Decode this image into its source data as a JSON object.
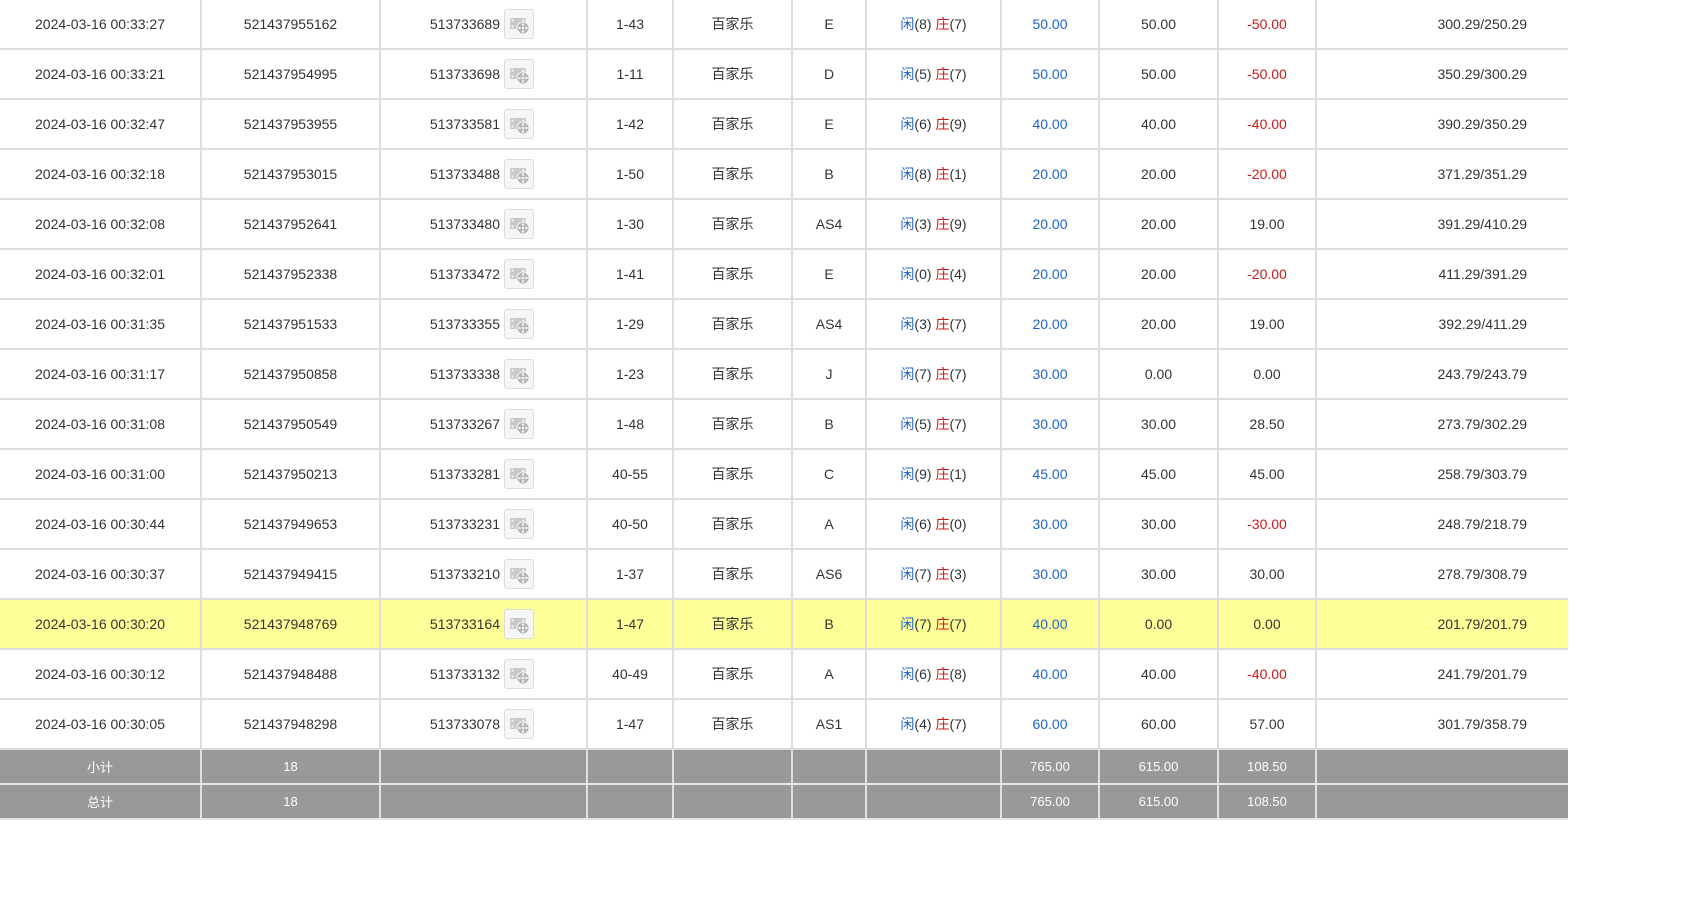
{
  "rows": [
    {
      "time": "2024-03-16 00:33:27",
      "bet_id": "521437955162",
      "round_id": "513733689",
      "table": "1-43",
      "game": "百家乐",
      "bet_area": "E",
      "player_label": "闲",
      "player_score": "(8)",
      "banker_label": "庄",
      "banker_score": "(7)",
      "bet_amount": "50.00",
      "valid_bet": "50.00",
      "payout": "-50.00",
      "payout_negative": true,
      "balance": "300.29/250.29",
      "highlight": false
    },
    {
      "time": "2024-03-16 00:33:21",
      "bet_id": "521437954995",
      "round_id": "513733698",
      "table": "1-11",
      "game": "百家乐",
      "bet_area": "D",
      "player_label": "闲",
      "player_score": "(5)",
      "banker_label": "庄",
      "banker_score": "(7)",
      "bet_amount": "50.00",
      "valid_bet": "50.00",
      "payout": "-50.00",
      "payout_negative": true,
      "balance": "350.29/300.29",
      "highlight": false
    },
    {
      "time": "2024-03-16 00:32:47",
      "bet_id": "521437953955",
      "round_id": "513733581",
      "table": "1-42",
      "game": "百家乐",
      "bet_area": "E",
      "player_label": "闲",
      "player_score": "(6)",
      "banker_label": "庄",
      "banker_score": "(9)",
      "bet_amount": "40.00",
      "valid_bet": "40.00",
      "payout": "-40.00",
      "payout_negative": true,
      "balance": "390.29/350.29",
      "highlight": false
    },
    {
      "time": "2024-03-16 00:32:18",
      "bet_id": "521437953015",
      "round_id": "513733488",
      "table": "1-50",
      "game": "百家乐",
      "bet_area": "B",
      "player_label": "闲",
      "player_score": "(8)",
      "banker_label": "庄",
      "banker_score": "(1)",
      "bet_amount": "20.00",
      "valid_bet": "20.00",
      "payout": "-20.00",
      "payout_negative": true,
      "balance": "371.29/351.29",
      "highlight": false
    },
    {
      "time": "2024-03-16 00:32:08",
      "bet_id": "521437952641",
      "round_id": "513733480",
      "table": "1-30",
      "game": "百家乐",
      "bet_area": "AS4",
      "player_label": "闲",
      "player_score": "(3)",
      "banker_label": "庄",
      "banker_score": "(9)",
      "bet_amount": "20.00",
      "valid_bet": "20.00",
      "payout": "19.00",
      "payout_negative": false,
      "balance": "391.29/410.29",
      "highlight": false
    },
    {
      "time": "2024-03-16 00:32:01",
      "bet_id": "521437952338",
      "round_id": "513733472",
      "table": "1-41",
      "game": "百家乐",
      "bet_area": "E",
      "player_label": "闲",
      "player_score": "(0)",
      "banker_label": "庄",
      "banker_score": "(4)",
      "bet_amount": "20.00",
      "valid_bet": "20.00",
      "payout": "-20.00",
      "payout_negative": true,
      "balance": "411.29/391.29",
      "highlight": false
    },
    {
      "time": "2024-03-16 00:31:35",
      "bet_id": "521437951533",
      "round_id": "513733355",
      "table": "1-29",
      "game": "百家乐",
      "bet_area": "AS4",
      "player_label": "闲",
      "player_score": "(3)",
      "banker_label": "庄",
      "banker_score": "(7)",
      "bet_amount": "20.00",
      "valid_bet": "20.00",
      "payout": "19.00",
      "payout_negative": false,
      "balance": "392.29/411.29",
      "highlight": false
    },
    {
      "time": "2024-03-16 00:31:17",
      "bet_id": "521437950858",
      "round_id": "513733338",
      "table": "1-23",
      "game": "百家乐",
      "bet_area": "J",
      "player_label": "闲",
      "player_score": "(7)",
      "banker_label": "庄",
      "banker_score": "(7)",
      "bet_amount": "30.00",
      "valid_bet": "0.00",
      "payout": "0.00",
      "payout_negative": false,
      "balance": "243.79/243.79",
      "highlight": false
    },
    {
      "time": "2024-03-16 00:31:08",
      "bet_id": "521437950549",
      "round_id": "513733267",
      "table": "1-48",
      "game": "百家乐",
      "bet_area": "B",
      "player_label": "闲",
      "player_score": "(5)",
      "banker_label": "庄",
      "banker_score": "(7)",
      "bet_amount": "30.00",
      "valid_bet": "30.00",
      "payout": "28.50",
      "payout_negative": false,
      "balance": "273.79/302.29",
      "highlight": false
    },
    {
      "time": "2024-03-16 00:31:00",
      "bet_id": "521437950213",
      "round_id": "513733281",
      "table": "40-55",
      "game": "百家乐",
      "bet_area": "C",
      "player_label": "闲",
      "player_score": "(9)",
      "banker_label": "庄",
      "banker_score": "(1)",
      "bet_amount": "45.00",
      "valid_bet": "45.00",
      "payout": "45.00",
      "payout_negative": false,
      "balance": "258.79/303.79",
      "highlight": false
    },
    {
      "time": "2024-03-16 00:30:44",
      "bet_id": "521437949653",
      "round_id": "513733231",
      "table": "40-50",
      "game": "百家乐",
      "bet_area": "A",
      "player_label": "闲",
      "player_score": "(6)",
      "banker_label": "庄",
      "banker_score": "(0)",
      "bet_amount": "30.00",
      "valid_bet": "30.00",
      "payout": "-30.00",
      "payout_negative": true,
      "balance": "248.79/218.79",
      "highlight": false
    },
    {
      "time": "2024-03-16 00:30:37",
      "bet_id": "521437949415",
      "round_id": "513733210",
      "table": "1-37",
      "game": "百家乐",
      "bet_area": "AS6",
      "player_label": "闲",
      "player_score": "(7)",
      "banker_label": "庄",
      "banker_score": "(3)",
      "bet_amount": "30.00",
      "valid_bet": "30.00",
      "payout": "30.00",
      "payout_negative": false,
      "balance": "278.79/308.79",
      "highlight": false
    },
    {
      "time": "2024-03-16 00:30:20",
      "bet_id": "521437948769",
      "round_id": "513733164",
      "table": "1-47",
      "game": "百家乐",
      "bet_area": "B",
      "player_label": "闲",
      "player_score": "(7)",
      "banker_label": "庄",
      "banker_score": "(7)",
      "bet_amount": "40.00",
      "valid_bet": "0.00",
      "payout": "0.00",
      "payout_negative": false,
      "balance": "201.79/201.79",
      "highlight": true
    },
    {
      "time": "2024-03-16 00:30:12",
      "bet_id": "521437948488",
      "round_id": "513733132",
      "table": "40-49",
      "game": "百家乐",
      "bet_area": "A",
      "player_label": "闲",
      "player_score": "(6)",
      "banker_label": "庄",
      "banker_score": "(8)",
      "bet_amount": "40.00",
      "valid_bet": "40.00",
      "payout": "-40.00",
      "payout_negative": true,
      "balance": "241.79/201.79",
      "highlight": false
    },
    {
      "time": "2024-03-16 00:30:05",
      "bet_id": "521437948298",
      "round_id": "513733078",
      "table": "1-47",
      "game": "百家乐",
      "bet_area": "AS1",
      "player_label": "闲",
      "player_score": "(4)",
      "banker_label": "庄",
      "banker_score": "(7)",
      "bet_amount": "60.00",
      "valid_bet": "60.00",
      "payout": "57.00",
      "payout_negative": false,
      "balance": "301.79/358.79",
      "highlight": false
    }
  ],
  "subtotal": {
    "label": "小计",
    "count": "18",
    "bet_amount": "765.00",
    "valid_bet": "615.00",
    "payout": "108.50"
  },
  "total": {
    "label": "总计",
    "count": "18",
    "bet_amount": "765.00",
    "valid_bet": "615.00",
    "payout": "108.50"
  },
  "icons": {
    "replay": "film-reel-icon"
  },
  "colors": {
    "player": "#1e64c8",
    "banker": "#d01818",
    "negative": "#d01818",
    "bet_amount": "#1e64c8",
    "highlight_row": "#ffff99",
    "total_row_bg": "#999999"
  }
}
